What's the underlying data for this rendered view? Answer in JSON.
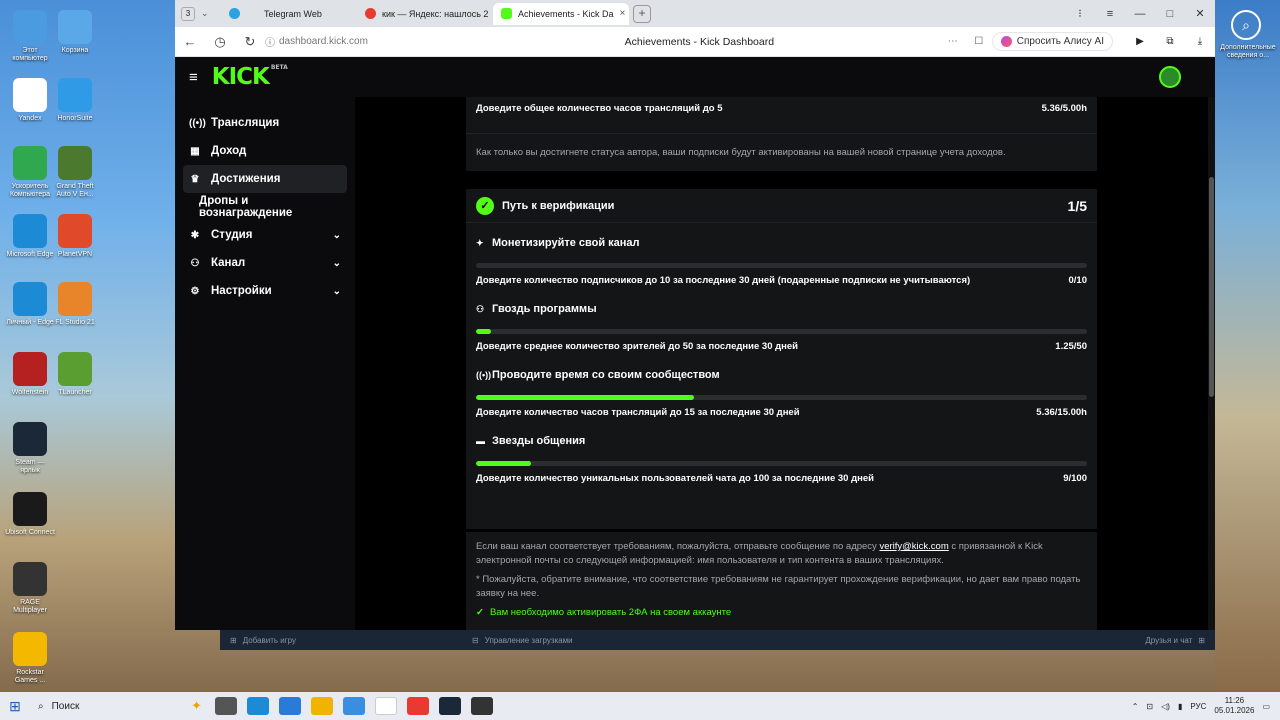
{
  "desktop": {
    "icons": [
      {
        "label": "Этот компьютер",
        "icon": "computer-icon",
        "color": "#4a9be0"
      },
      {
        "label": "Корзина",
        "icon": "recycle-bin-icon",
        "color": "#5aa8e8"
      },
      {
        "label": "Yandex",
        "icon": "yandex-icon",
        "color": "#ffffff"
      },
      {
        "label": "HonorSuite",
        "icon": "honor-suite-icon",
        "color": "#2f9be6"
      },
      {
        "label": "Ускоритель Компьютера",
        "icon": "speedometer-icon",
        "color": "#2fa84f"
      },
      {
        "label": "Grand Theft Auto V Ен...",
        "icon": "gta-icon",
        "color": "#4b7a2e"
      },
      {
        "label": "Microsoft Edge",
        "icon": "edge-icon",
        "color": "#1d8ad6"
      },
      {
        "label": "PlanetVPN",
        "icon": "planet-vpn-icon",
        "color": "#e04a2a"
      },
      {
        "label": "Личный - Edge",
        "icon": "edge-icon",
        "color": "#1d8ad6"
      },
      {
        "label": "FL Studio 21",
        "icon": "fl-studio-icon",
        "color": "#e8842a"
      },
      {
        "label": "Wolfenstein",
        "icon": "wolfenstein-icon",
        "color": "#b52020"
      },
      {
        "label": "TLauncher",
        "icon": "tlauncher-icon",
        "color": "#5a9e32"
      },
      {
        "label": "Steam — ярлык",
        "icon": "steam-icon",
        "color": "#1b2838"
      },
      {
        "label": "Ubisoft Connect",
        "icon": "ubisoft-icon",
        "color": "#1a1a1a"
      },
      {
        "label": "RAGE Multiplayer",
        "icon": "rage-icon",
        "color": "#333333"
      },
      {
        "label": "Rockstar Games ...",
        "icon": "rockstar-icon",
        "color": "#f5b800"
      }
    ],
    "right_icon_label": "Дополнительные сведения о..."
  },
  "tabs": {
    "count": "3",
    "items": [
      {
        "label": "Telegram Web",
        "icon": "telegram-icon",
        "color": "#2aa3e0"
      },
      {
        "label": "кик — Яндекс: нашлось 2",
        "icon": "yandex-icon",
        "color": "#e83a30"
      },
      {
        "label": "Achievements - Kick Da",
        "icon": "kick-icon",
        "color": "#53fc18"
      }
    ],
    "new_tab": "+"
  },
  "address": {
    "url": "dashboard.kick.com",
    "page_title": "Achievements - Kick Dashboard",
    "alice": "Спросить Алису AI"
  },
  "kick": {
    "logo": "KICK",
    "logo_tag": "BETA",
    "accent": "#53fc18"
  },
  "sidebar": {
    "items": [
      {
        "label": "Трансляция",
        "icon": "broadcast-icon"
      },
      {
        "label": "Доход",
        "icon": "income-icon"
      },
      {
        "label": "Достижения",
        "icon": "trophy-icon"
      },
      {
        "label": "Дропы и вознаграждение",
        "icon": ""
      },
      {
        "label": "Студия",
        "icon": "studio-icon"
      },
      {
        "label": "Канал",
        "icon": "channel-icon"
      },
      {
        "label": "Настройки",
        "icon": "settings-icon"
      }
    ]
  },
  "main": {
    "affiliate": {
      "req_label": "Доведите общее количество часов трансляций до 5",
      "req_value": "5.36/5.00h",
      "note": "Как только вы достигнете статуса автора, ваши подписки будут активированы на вашей новой странице учета доходов."
    },
    "verification": {
      "title": "Путь к верификации",
      "count": "1/5",
      "sections": [
        {
          "title": "Монетизируйте свой канал",
          "icon": "sparkle-icon",
          "desc": "Доведите количество подписчиков до 10 за последние 30 дней (подаренные подписки не учитываются)",
          "value": "0/10",
          "progress": 0
        },
        {
          "title": "Гвоздь программы",
          "icon": "users-icon",
          "desc": "Доведите среднее количество зрителей до 50 за последние 30 дней",
          "value": "1.25/50",
          "progress": 0.025
        },
        {
          "title": "Проводите время со своим сообществом",
          "icon": "broadcast-icon",
          "desc": "Доведите количество часов трансляций до 15 за последние 30 дней",
          "value": "5.36/15.00h",
          "progress": 0.357
        },
        {
          "title": "Звезды общения",
          "icon": "chat-icon",
          "desc": "Доведите количество уникальных пользователей чата до 100 за последние 30 дней",
          "value": "9/100",
          "progress": 0.09
        }
      ],
      "footer_before": "Если ваш канал соответствует требованиям, пожалуйста, отправьте сообщение по адресу",
      "footer_email": "verify@kick.com",
      "footer_after": "с привязанной к Kick электронной почты со следующей информацией: имя пользователя и тип контента в ваших трансляциях.",
      "footer_note": "* Пожалуйста, обратите внимание, что соответствие требованиям не гарантирует прохождение верификации, но дает вам право подать заявку на нее.",
      "twofa": "Вам необходимо активировать 2ФА на своем аккаунте"
    }
  },
  "steam_bar": {
    "add_game": "Добавить игру",
    "downloads": "Управление загрузками",
    "friends": "Друзья и чат"
  },
  "taskbar": {
    "search": "Поиск",
    "lang": "РУС",
    "time": "11:26",
    "date": "05.01.2026"
  }
}
